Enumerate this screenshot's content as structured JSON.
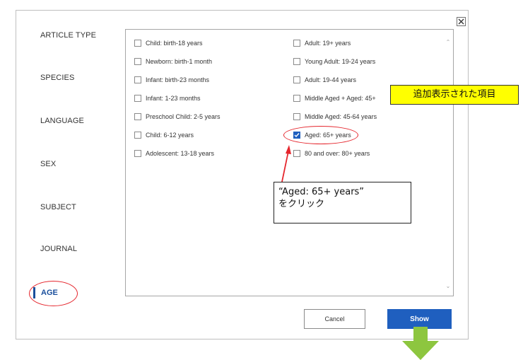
{
  "sidebar": {
    "items": [
      {
        "label": "ARTICLE TYPE"
      },
      {
        "label": "SPECIES"
      },
      {
        "label": "LANGUAGE"
      },
      {
        "label": "SEX"
      },
      {
        "label": "SUBJECT"
      },
      {
        "label": "JOURNAL"
      },
      {
        "label": "AGE",
        "active": true
      }
    ]
  },
  "options": {
    "left": [
      {
        "label": "Child: birth-18 years",
        "checked": false
      },
      {
        "label": "Newborn: birth-1 month",
        "checked": false
      },
      {
        "label": "Infant: birth-23 months",
        "checked": false
      },
      {
        "label": "Infant: 1-23 months",
        "checked": false
      },
      {
        "label": "Preschool Child: 2-5 years",
        "checked": false
      },
      {
        "label": "Child: 6-12 years",
        "checked": false
      },
      {
        "label": "Adolescent: 13-18 years",
        "checked": false
      }
    ],
    "right": [
      {
        "label": "Adult: 19+ years",
        "checked": false
      },
      {
        "label": "Young Adult: 19-24 years",
        "checked": false
      },
      {
        "label": "Adult: 19-44 years",
        "checked": false
      },
      {
        "label": "Middle Aged + Aged: 45+",
        "checked": false
      },
      {
        "label": "Middle Aged: 45-64 years",
        "checked": false
      },
      {
        "label": "Aged: 65+ years",
        "checked": true
      },
      {
        "label": "80 and over: 80+ years",
        "checked": false
      }
    ]
  },
  "annotations": {
    "callout_line1": "“Aged: 65+ years”",
    "callout_line2": "をクリック",
    "added_items_label": "追加表示された項目"
  },
  "buttons": {
    "cancel": "Cancel",
    "show": "Show"
  },
  "colors": {
    "accent_blue": "#1f5fbf",
    "highlight_red": "#e5262d",
    "label_yellow": "#ffff00",
    "arrow_green": "#8dc63f"
  }
}
